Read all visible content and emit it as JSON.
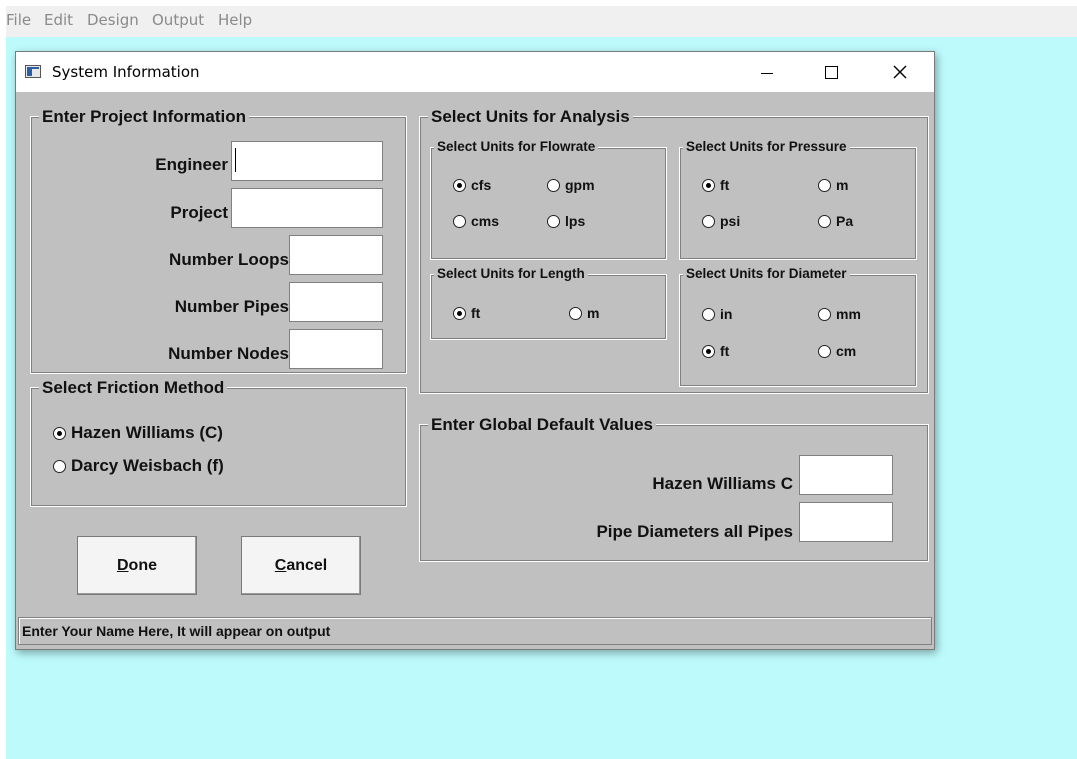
{
  "menu": {
    "file": "File",
    "edit": "Edit",
    "design": "Design",
    "output": "Output",
    "help": "Help"
  },
  "window": {
    "title": "System Information"
  },
  "project": {
    "legend": "Enter Project Information",
    "engineer_label": "Engineer",
    "engineer_value": "",
    "project_label": "Project",
    "project_value": "",
    "loops_label": "Number Loops",
    "loops_value": "",
    "pipes_label": "Number Pipes",
    "pipes_value": "",
    "nodes_label": "Number Nodes",
    "nodes_value": ""
  },
  "friction": {
    "legend": "Select Friction Method",
    "hazen": "Hazen Williams  (C)",
    "darcy": "Darcy Weisbach (f)",
    "selected": "hazen"
  },
  "buttons": {
    "done_mnemonic": "D",
    "done_rest": "one",
    "cancel_mnemonic": "C",
    "cancel_rest": "ancel"
  },
  "units": {
    "legend": "Select Units for Analysis",
    "flowrate": {
      "legend": "Select Units for Flowrate",
      "cfs": "cfs",
      "gpm": "gpm",
      "cms": "cms",
      "lps": "lps",
      "selected": "cfs"
    },
    "pressure": {
      "legend": "Select Units for Pressure",
      "ft": "ft",
      "m": "m",
      "psi": "psi",
      "pa": "Pa",
      "selected": "ft"
    },
    "length": {
      "legend": "Select Units for Length",
      "ft": "ft",
      "m": "m",
      "selected": "ft"
    },
    "diameter": {
      "legend": "Select Units for Diameter",
      "in": "in",
      "mm": "mm",
      "ft": "ft",
      "cm": "cm",
      "selected": "ft"
    }
  },
  "defaults": {
    "legend": "Enter Global Default Values",
    "hazen_c_label": "Hazen Williams C",
    "hazen_c_value": "",
    "pipe_diam_label": "Pipe Diameters all Pipes",
    "pipe_diam_value": ""
  },
  "status": {
    "text": "Enter Your Name Here, It will appear on output"
  },
  "colors": {
    "desktop": "#bdfafc",
    "dialog": "#c0c0c0",
    "menubar": "#f0f0f0"
  }
}
